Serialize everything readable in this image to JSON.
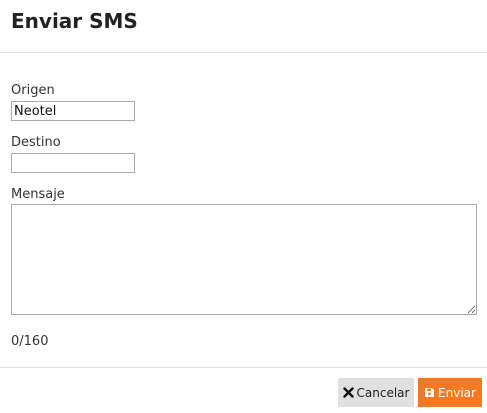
{
  "dialog": {
    "title": "Enviar SMS"
  },
  "form": {
    "origen": {
      "label": "Origen",
      "value": "Neotel"
    },
    "destino": {
      "label": "Destino",
      "value": ""
    },
    "mensaje": {
      "label": "Mensaje",
      "value": ""
    },
    "counter": "0/160"
  },
  "footer": {
    "cancel_label": "Cancelar",
    "cancel_icon": "times-icon",
    "send_label": "Enviar",
    "send_icon": "save-icon",
    "send_color": "#f47920",
    "cancel_color": "#e0e0e0"
  }
}
